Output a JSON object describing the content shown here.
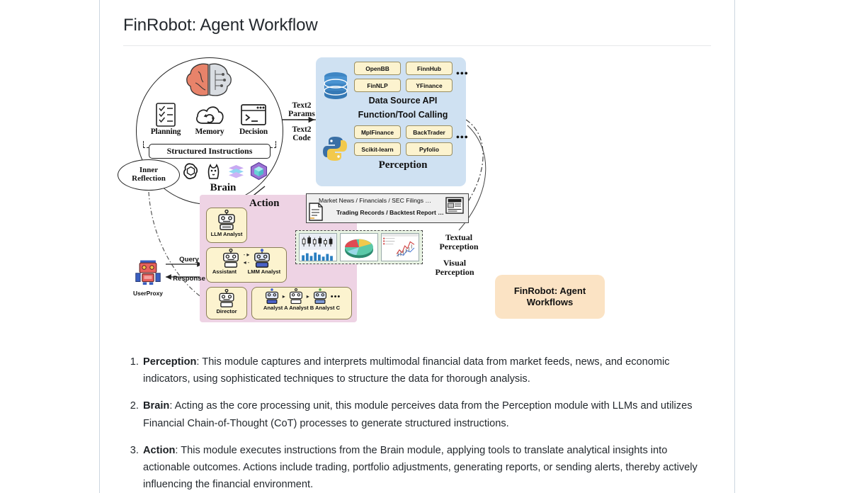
{
  "page": {
    "title": "FinRobot: Agent Workflow"
  },
  "figure": {
    "brain": {
      "label": "Brain",
      "cognition": [
        {
          "name": "Planning",
          "icon": "checklist-icon"
        },
        {
          "name": "Memory",
          "icon": "cloud-refresh-icon"
        },
        {
          "name": "Decision",
          "icon": "terminal-icon"
        }
      ],
      "structured_instructions": "Structured Instructions",
      "inner_reflection_line1": "Inner",
      "inner_reflection_line2": "Reflection",
      "llm_logos": [
        "openai-logo",
        "llama-logo",
        "layers-logo",
        "cube-logo"
      ],
      "brain_icon": "brain-icon"
    },
    "bridge": {
      "text2params_line1": "Text2",
      "text2params_line2": "Params",
      "text2code_line1": "Text2",
      "text2code_line2": "Code"
    },
    "perception": {
      "label": "Perception",
      "data_source_api": {
        "label": "Data Source API",
        "icon": "database-icon",
        "items": [
          "OpenBB",
          "FinnHub",
          "FinNLP",
          "YFinance"
        ],
        "more": "•••"
      },
      "function_tool_calling": {
        "label": "Function/Tool Calling",
        "icon": "python-icon",
        "items": [
          "MplFinance",
          "BackTrader",
          "Scikit-learn",
          "Pyfolio"
        ],
        "more": "•••"
      }
    },
    "action": {
      "label": "Action",
      "agents": {
        "llm_analyst": "LLM Analyst",
        "assistant": "Assistant",
        "lmm_analyst": "LMM Analyst",
        "director": "Director",
        "analysts": "Analyst A Analyst B Analyst C",
        "analysts_more": "•••"
      }
    },
    "user_proxy": {
      "label": "UserProxy",
      "query": "Query",
      "response": "Response"
    },
    "textual": {
      "line1": "Market News / Financials / SEC Filings …",
      "line2": "Trading Records / Backtest Report …",
      "doc_icon": "document-icon",
      "news_icon": "newspaper-icon",
      "label_line1": "Textual",
      "label_line2": "Perception"
    },
    "visual": {
      "charts": [
        "candlestick-chart",
        "pie-chart",
        "stock-report-chart"
      ],
      "label_line1": "Visual",
      "label_line2": "Perception"
    },
    "finrobot_box": {
      "line1": "FinRobot: Agent",
      "line2": "Workflows"
    }
  },
  "modules": [
    {
      "term": "Perception",
      "separator": ": ",
      "text": "This module captures and interprets multimodal financial data from market feeds, news, and economic indicators, using sophisticated techniques to structure the data for thorough analysis."
    },
    {
      "term": "Brain",
      "separator": ": ",
      "text": "Acting as the core processing unit, this module perceives data from the Perception module with LLMs and utilizes Financial Chain-of-Thought (CoT) processes to generate structured instructions."
    },
    {
      "term": "Action",
      "separator": ": ",
      "text": "This module executes instructions from the Brain module, applying tools to translate analytical insights into actionable outcomes. Actions include trading, portfolio adjustments, generating reports, or sending alerts, thereby actively influencing the financial environment."
    }
  ],
  "colors": {
    "perception_panel": "#cfe1f2",
    "action_panel": "#eed3e4",
    "agent_card": "#fcf3cf",
    "finrobot_box": "#fbe3c4",
    "visual_strip": "#e7f2e2",
    "rail": "#ccd6e0"
  }
}
